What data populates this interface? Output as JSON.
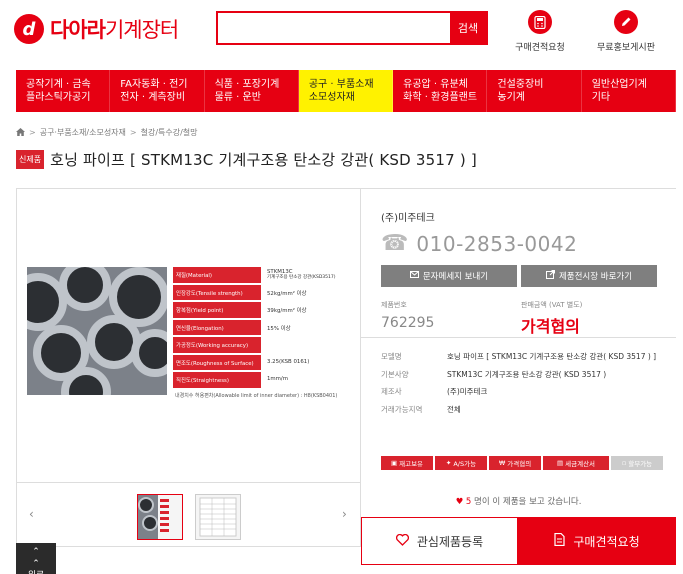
{
  "header": {
    "logo_letter": "d",
    "logo_brand": "다아라",
    "logo_suffix": "기계장터",
    "search_placeholder": "",
    "search_button": "검색",
    "quote_link": "구매견적요청",
    "promo_link": "무료홍보게시판"
  },
  "nav": [
    {
      "line1": "공작기계 · 금속",
      "line2": "플라스틱가공기"
    },
    {
      "line1": "FA자동화 · 전기",
      "line2": "전자 · 계측장비"
    },
    {
      "line1": "식품 · 포장기계",
      "line2": "물류 · 운반"
    },
    {
      "line1": "공구 · 부품소재",
      "line2": "소모성자재"
    },
    {
      "line1": "유공압 · 유분체",
      "line2": "화학 · 환경플랜트"
    },
    {
      "line1": "건설중장비",
      "line2": "농기계"
    },
    {
      "line1": "일반산업기계",
      "line2": "기타"
    }
  ],
  "breadcrumb": [
    "공구·부품소재/소모성자재",
    "철강/특수강/철망"
  ],
  "product": {
    "badge": "신제품",
    "title": "호닝 파이프 [ STKM13C 기계구조용 탄소강 강관( KSD 3517 ) ]"
  },
  "spec_image": {
    "rows": [
      {
        "k": "재질(Material)",
        "v": "STKM13C",
        "v2": "기계구조용 탄소강 강관(KSD3517)"
      },
      {
        "k": "인장강도(Tensile strength)",
        "v": "52kg/mm² 이상"
      },
      {
        "k": "항복점(Yield point)",
        "v": "39kg/mm² 이상"
      },
      {
        "k": "연신율(Elongation)",
        "v": "15%  이상"
      },
      {
        "k": "가공정도(Working accuracy)",
        "v": ""
      },
      {
        "k": "면조도(Roughness of Surface)",
        "v": "3.25(KSB 0161)"
      },
      {
        "k": "직진도(Straightness)",
        "v": "1mm/m"
      }
    ],
    "footnote": "내경치수 허용편차(Allowable limit of inner diameter) : H8(KSB0401)"
  },
  "seller": {
    "name": "(주)미주테크",
    "phone": "010-2853-0042",
    "msg_button": "문자메세지 보내기",
    "showroom_button": "제품전시장 바로가기"
  },
  "code": {
    "label": "제품번호",
    "value": "762295"
  },
  "price": {
    "label": "판매금액 (VAT 별도)",
    "value": "가격협의"
  },
  "details": [
    {
      "k": "모델명",
      "v": "호닝 파이프 [ STKM13C 기계구조용 탄소강 강관( KSD 3517 ) ]"
    },
    {
      "k": "기본사양",
      "v": "STKM13C 기계구조용 탄소강 강관( KSD 3517 )"
    },
    {
      "k": "제조사",
      "v": "(주)미주테크"
    },
    {
      "k": "거래가능지역",
      "v": "전체"
    }
  ],
  "tags": [
    {
      "label": "재고보유",
      "active": true
    },
    {
      "label": "A/S가능",
      "active": true
    },
    {
      "label": "가격협의",
      "active": true
    },
    {
      "label": "세금계산서",
      "active": true
    },
    {
      "label": "할부가능",
      "active": false
    }
  ],
  "views": {
    "count": "5",
    "text": "명이 이 제품을 보고 갔습니다."
  },
  "actions": {
    "wishlist": "관심제품등록",
    "quote": "구매견적요청"
  },
  "scroll_top": "위로"
}
